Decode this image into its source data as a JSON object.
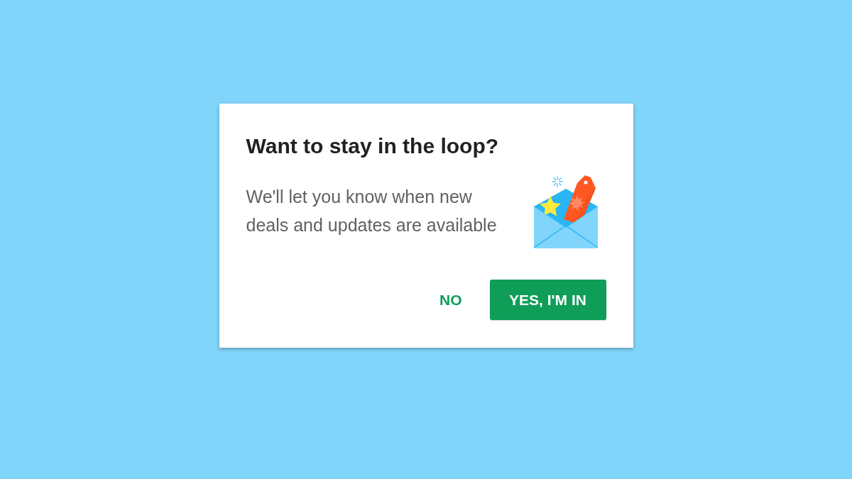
{
  "dialog": {
    "title": "Want to stay in the loop?",
    "message": "We'll let you know when new deals and updates are available",
    "buttons": [
      {
        "label": "NO",
        "kind": "text"
      },
      {
        "label": "YES, I'M IN",
        "kind": "filled"
      }
    ]
  }
}
